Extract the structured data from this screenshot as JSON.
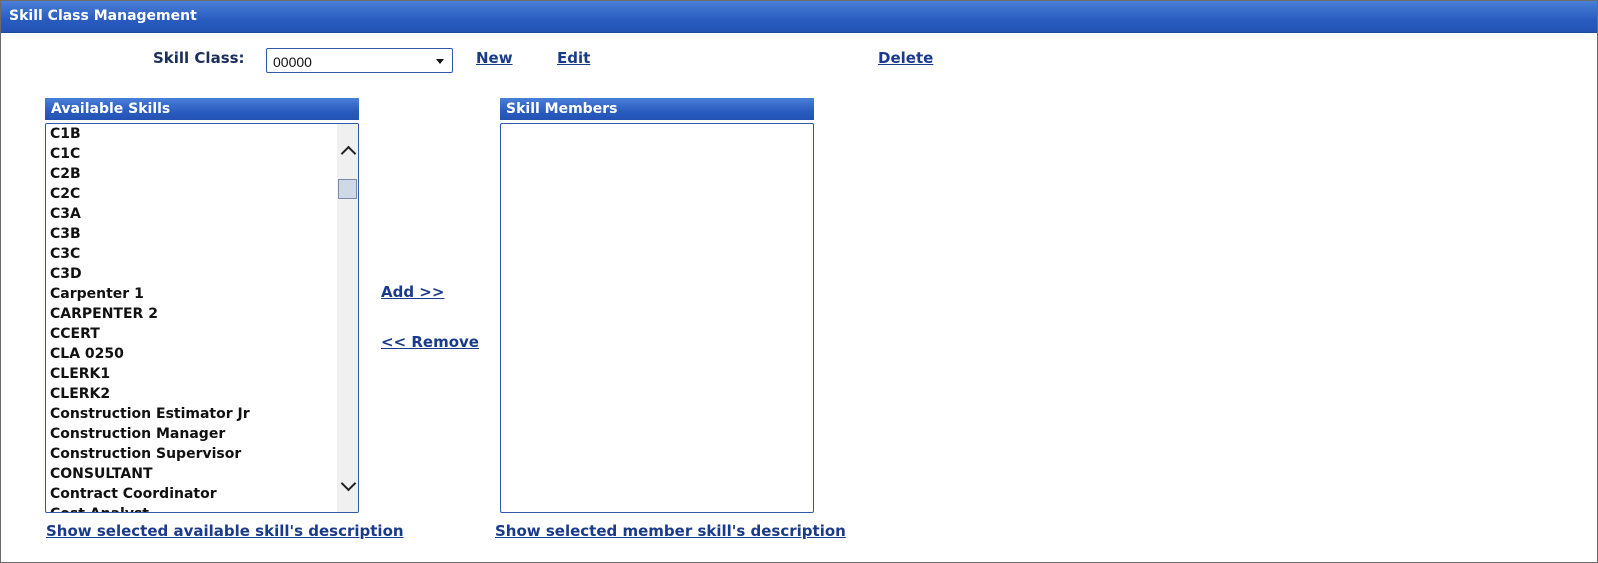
{
  "window": {
    "title": "Skill Class Management"
  },
  "skill_class": {
    "label": "Skill Class:",
    "selected": "00000"
  },
  "actions": {
    "new": "New",
    "edit": "Edit",
    "delete": "Delete"
  },
  "available": {
    "header": "Available Skills",
    "items": [
      "C1B",
      "C1C",
      "C2B",
      "C2C",
      "C3A",
      "C3B",
      "C3C",
      "C3D",
      "Carpenter 1",
      "CARPENTER 2",
      "CCERT",
      "CLA 0250",
      "CLERK1",
      "CLERK2",
      "Construction Estimator Jr",
      "Construction Manager",
      "Construction Supervisor",
      "CONSULTANT",
      "Contract Coordinator",
      "Cost Analyst"
    ],
    "describe_link": "Show selected available skill's description"
  },
  "transfer": {
    "add": "Add >>",
    "remove": "<< Remove"
  },
  "members": {
    "header": "Skill Members",
    "items": [],
    "describe_link": "Show selected member skill's description"
  }
}
